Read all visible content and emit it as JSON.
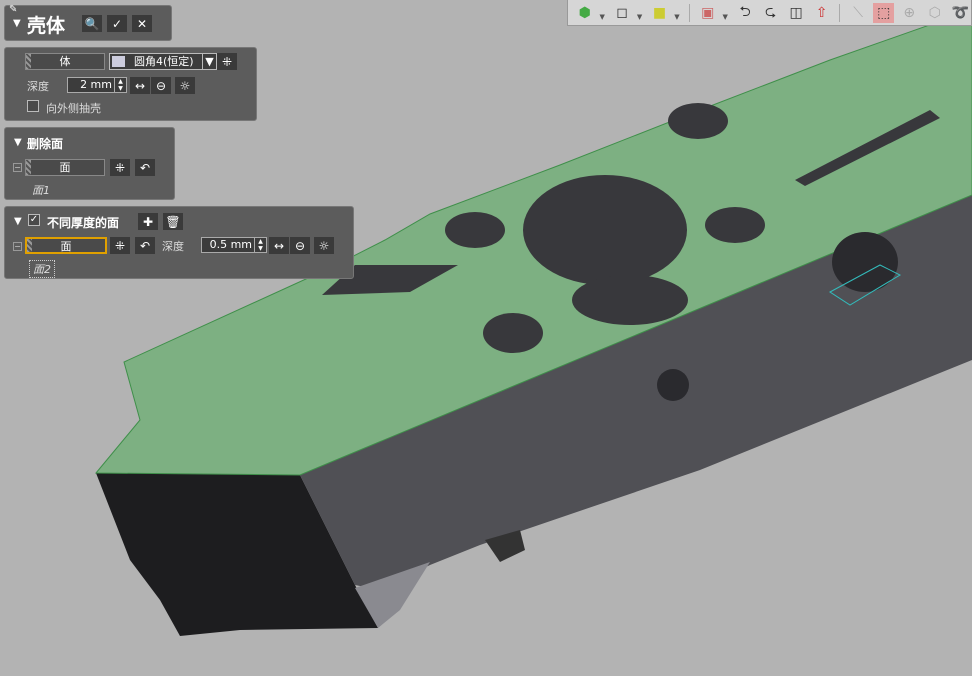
{
  "shell": {
    "title": "壳体",
    "preview": "🔍",
    "ok": "✓",
    "cancel": "✕"
  },
  "body_section": {
    "body_field": "体",
    "body_value": "圆角4(恒定)",
    "depth_label": "深度",
    "depth_value": "2 mm",
    "outward_label": "向外侧抽壳"
  },
  "remove_faces": {
    "title": "删除面",
    "field": "面",
    "item": "面1"
  },
  "diff_thickness": {
    "title": "不同厚度的面",
    "field": "面",
    "depth_label": "深度",
    "depth_value": "0.5 mm",
    "item": "面2",
    "checked": true
  },
  "colors": {
    "face": "#7db082",
    "panel": "#5c5c5c",
    "active_border": "#e0a000"
  }
}
